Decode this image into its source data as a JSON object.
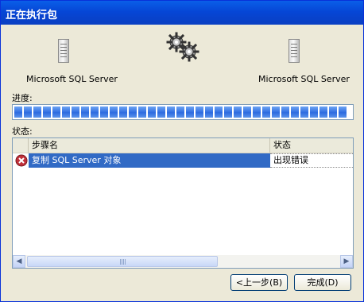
{
  "window": {
    "title": "正在执行包"
  },
  "source": {
    "label": "Microsoft SQL Server",
    "icon": "server-icon"
  },
  "destination": {
    "label": "Microsoft SQL Server",
    "icon": "server-icon"
  },
  "activity_icon": "gears-icon",
  "progress": {
    "label": "进度:",
    "value_fraction": 1.0
  },
  "status": {
    "label": "状态:",
    "columns": [
      "步骤名",
      "状态"
    ],
    "rows": [
      {
        "step": "复制 SQL Server 对象",
        "state": "出现错误",
        "icon": "error-icon",
        "selected": true
      }
    ]
  },
  "buttons": {
    "back": "<上一步(B)",
    "finish": "完成(D)"
  },
  "colors": {
    "title_bar": "#0a4fd6",
    "progress": "#2d6be0",
    "selection": "#316ac5",
    "error": "#c0303a"
  }
}
